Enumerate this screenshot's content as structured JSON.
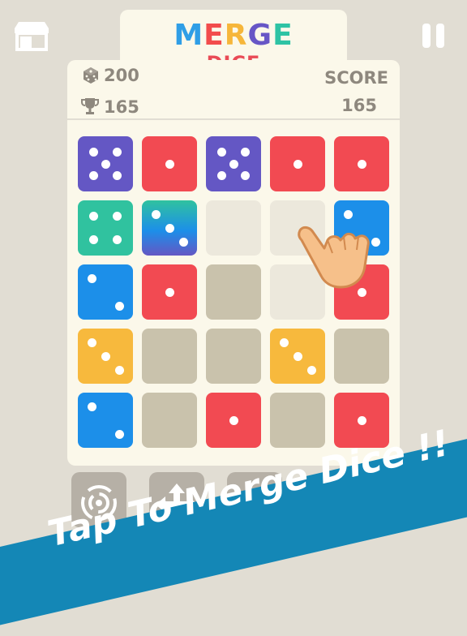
{
  "header": {
    "shop_icon": "shop-icon",
    "pause_icon": "pause-icon",
    "title_merge_letters": [
      {
        "ch": "M",
        "color": "#2f9ee6"
      },
      {
        "ch": "E",
        "color": "#f24c4c"
      },
      {
        "ch": "R",
        "color": "#f6b63a"
      },
      {
        "ch": "G",
        "color": "#6756c6"
      },
      {
        "ch": "E",
        "color": "#2ec3a4"
      }
    ],
    "title_dice": "DICE"
  },
  "stats": {
    "dice_count": "200",
    "best": "165",
    "score_label": "SCORE",
    "score": "165"
  },
  "board": {
    "colors": {
      "purple": "#6457c4",
      "red": "#f24a52",
      "teal": "#30c29f",
      "blue": "#1c8fe9",
      "yellow": "#f7b93d",
      "empty": "#c9c2ac"
    },
    "rows": [
      [
        {
          "c": "purple",
          "v": 5
        },
        {
          "c": "red",
          "v": 1
        },
        {
          "c": "purple",
          "v": 5
        },
        {
          "c": "red",
          "v": 1
        },
        {
          "c": "red",
          "v": 1
        }
      ],
      [
        {
          "c": "teal",
          "v": 4
        },
        {
          "c": "gradient",
          "v": 3
        },
        {
          "c": "faded",
          "v": 0
        },
        {
          "c": "faded",
          "v": 0
        },
        {
          "c": "blue",
          "v": 2
        }
      ],
      [
        {
          "c": "blue",
          "v": 2
        },
        {
          "c": "red",
          "v": 1
        },
        {
          "c": "empty",
          "v": 0
        },
        {
          "c": "faded",
          "v": 0
        },
        {
          "c": "red",
          "v": 1
        }
      ],
      [
        {
          "c": "yellow",
          "v": 3
        },
        {
          "c": "empty",
          "v": 0
        },
        {
          "c": "empty",
          "v": 0
        },
        {
          "c": "yellow",
          "v": 3
        },
        {
          "c": "empty",
          "v": 0
        }
      ],
      [
        {
          "c": "blue",
          "v": 2
        },
        {
          "c": "empty",
          "v": 0
        },
        {
          "c": "red",
          "v": 1
        },
        {
          "c": "empty",
          "v": 0
        },
        {
          "c": "red",
          "v": 1
        }
      ]
    ]
  },
  "tools": [
    "tornado-icon",
    "arrows-icon",
    "hidden-tool-icon"
  ],
  "banner": {
    "text": "Tap To Merge Dice !!"
  }
}
